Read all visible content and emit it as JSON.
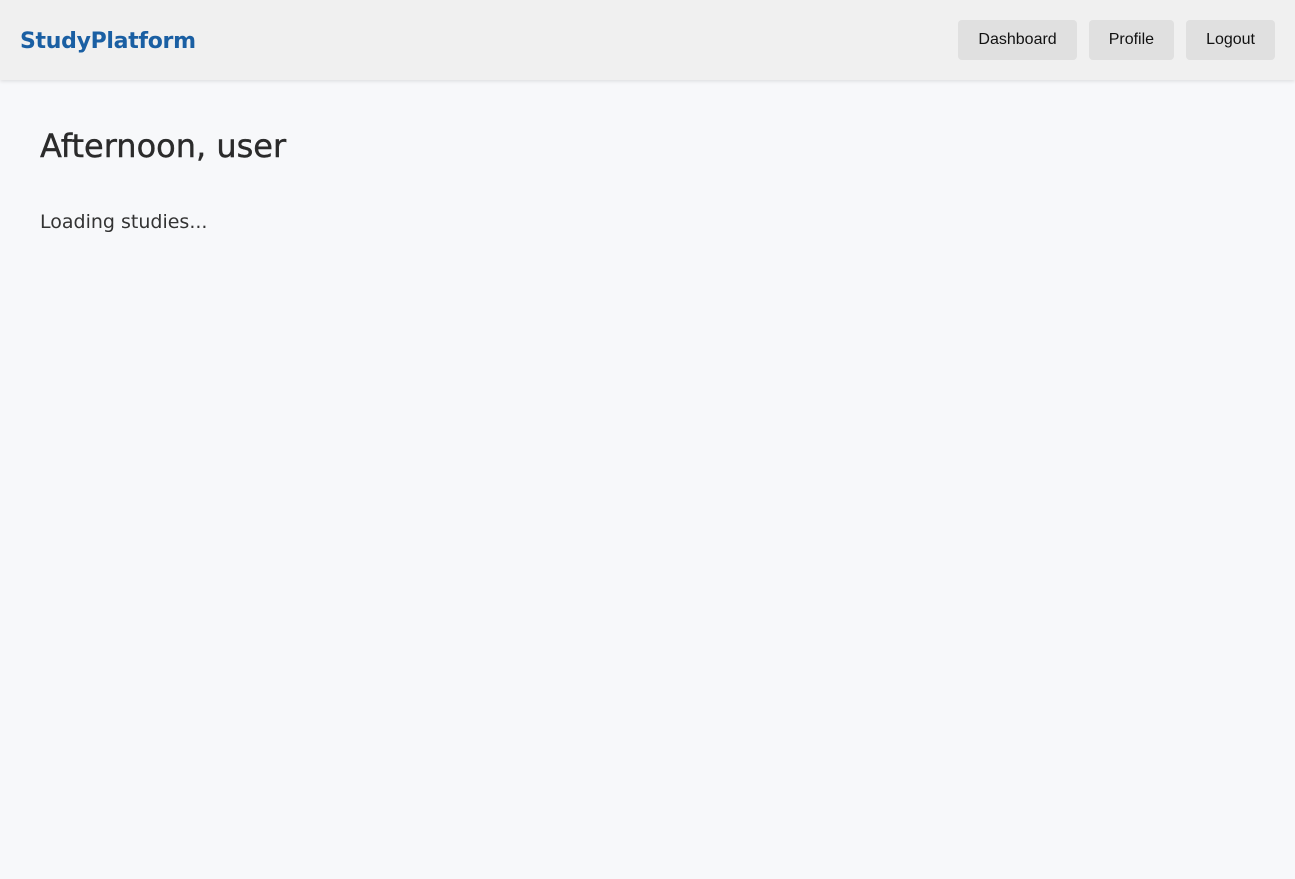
{
  "header": {
    "brand": "StudyPlatform",
    "nav": [
      {
        "label": "Dashboard"
      },
      {
        "label": "Profile"
      },
      {
        "label": "Logout"
      }
    ]
  },
  "main": {
    "greeting": "Afternoon, user",
    "status": "Loading studies..."
  },
  "colors": {
    "brand": "#1a5fa3",
    "header_bg": "#f0f0f0",
    "page_bg": "#f7f8fa",
    "button_bg": "#e0e0e0"
  }
}
